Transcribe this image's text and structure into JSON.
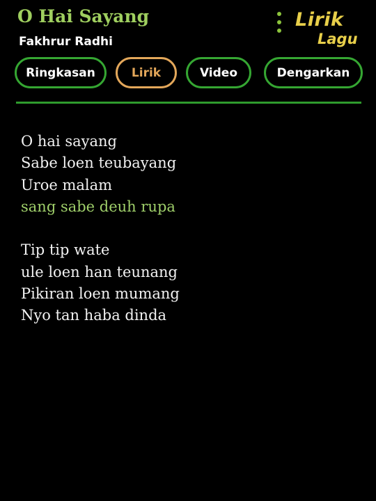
{
  "header": {
    "song_title": "O Hai Sayang",
    "artist": "Fakhrur Radhi",
    "logo": {
      "line1": "Lirik",
      "line2": "Lagu"
    },
    "menu_icon": "more-vertical-icon"
  },
  "tabs": [
    {
      "label": "Ringkasan",
      "active": false
    },
    {
      "label": "Lirik",
      "active": true
    },
    {
      "label": "Video",
      "active": false
    },
    {
      "label": "Dengarkan",
      "active": false
    }
  ],
  "lyrics": {
    "stanzas": [
      {
        "lines": [
          {
            "text": "O hai sayang",
            "highlighted": false
          },
          {
            "text": "Sabe loen teubayang",
            "highlighted": false
          },
          {
            "text": "Uroe malam",
            "highlighted": false
          },
          {
            "text": "sang sabe deuh rupa",
            "highlighted": true
          }
        ]
      },
      {
        "lines": [
          {
            "text": "Tip tip wate",
            "highlighted": false
          },
          {
            "text": "ule loen han teunang",
            "highlighted": false
          },
          {
            "text": "Pikiran loen mumang",
            "highlighted": false
          },
          {
            "text": "Nyo tan haba dinda",
            "highlighted": false
          }
        ]
      }
    ]
  },
  "colors": {
    "background": "#000000",
    "title": "#9fcf5f",
    "tab_border": "#35a632",
    "tab_active": "#e3a75a",
    "divider": "#2f9b2d",
    "logo": "#e8cf4a",
    "lyric_text": "#f2f2f2",
    "lyric_highlight": "#9fcf6a"
  }
}
